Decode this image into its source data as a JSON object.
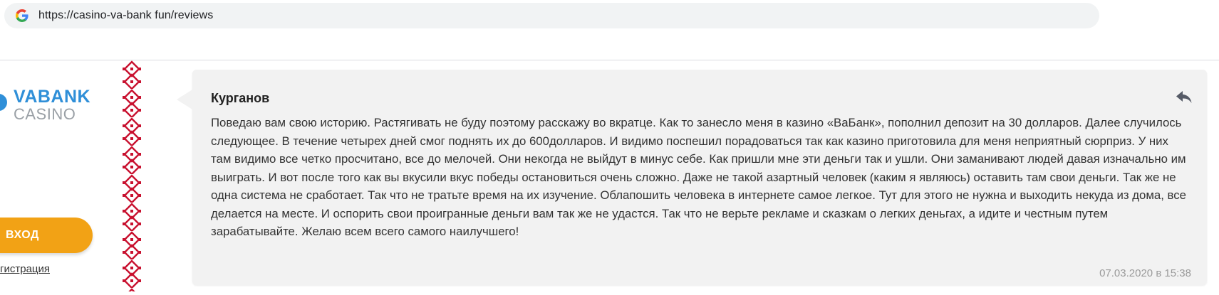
{
  "browser": {
    "url": "https://casino-va-bank fun/reviews"
  },
  "sidebar": {
    "logo_primary": "VABANK",
    "logo_secondary": "CASINO",
    "login_label": "ВХОД",
    "register_label": "гистрация"
  },
  "review": {
    "author": "Курганов",
    "text": "Поведаю вам свою историю. Растягивать не буду поэтому расскажу во вкратце. Как то занесло меня в казино «ВаБанк», пополнил депозит на 30 долларов. Далее случилось следующее. В течение четырех дней смог поднять их до 600долларов. И видимо поспешил порадоваться так как казино приготовила для меня неприятный сюрприз. У них там видимо все четко просчитано, все до мелочей. Они некогда не выйдут в минус себе. Как пришли мне эти деньги так и ушли. Они заманивают людей давая изначально им выиграть. И вот после того как вы вкусили вкус победы остановиться очень сложно. Даже не такой азартный человек (каким я являюсь) оставить там свои деньги. Так же не одна система не сработает. Так что не тратьте время на их изучение. Облапошить человека в интернете самое легкое. Тут для этого не нужна и выходить некуда из дома, все делается на месте. И оспорить свои проигранные деньги вам так же не удастся. Так что не верьте рекламе и сказкам о легких деньгах, а идите и честным путем зарабатывайте. Желаю всем всего самого наилучшего!",
    "date": "07.03.2020 в 15:38"
  },
  "colors": {
    "accent_blue": "#2f8fd8",
    "button_orange": "#f2a215",
    "ornament_red": "#c8102e",
    "card_bg": "#f2f2f2"
  },
  "icons": {
    "browser_favicon": "google-g-icon",
    "reply": "reply-icon"
  }
}
